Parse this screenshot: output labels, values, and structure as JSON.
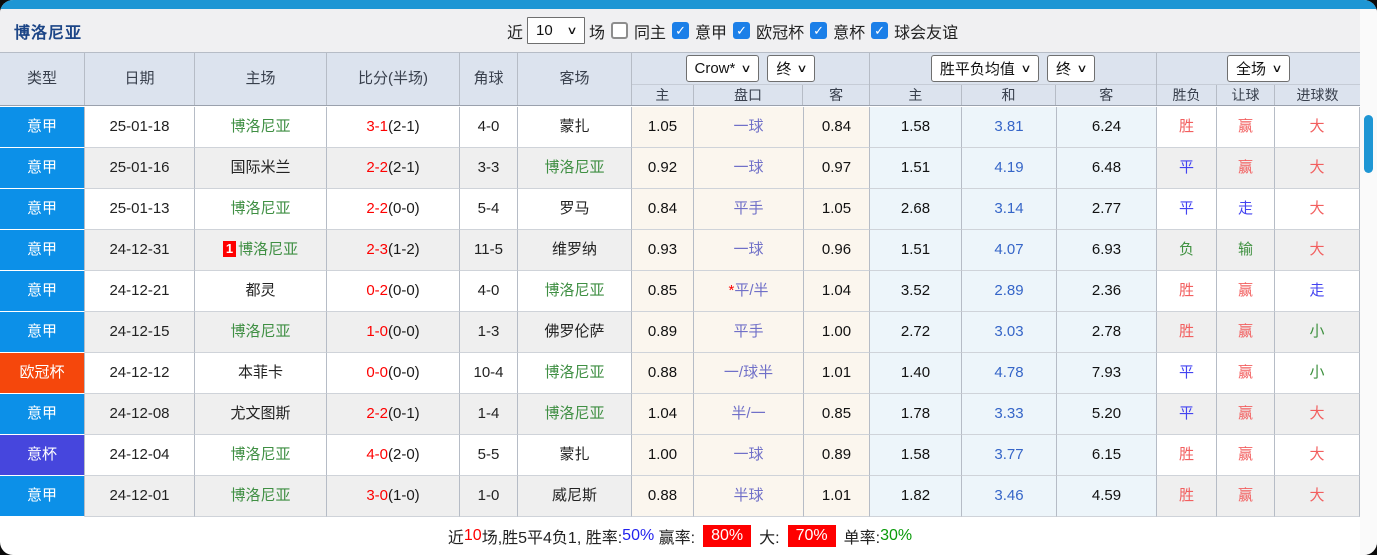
{
  "toolbar": {
    "title": "博洛尼亚",
    "recent_label": "近",
    "recent_value": "10",
    "games_label": "场",
    "same_home_label": "同主",
    "same_home_checked": false,
    "filters": [
      {
        "label": "意甲",
        "checked": true
      },
      {
        "label": "欧冠杯",
        "checked": true
      },
      {
        "label": "意杯",
        "checked": true
      },
      {
        "label": "球会友谊",
        "checked": true
      }
    ],
    "check_glyph": "✓"
  },
  "header": {
    "left_cols": [
      "类型",
      "日期",
      "主场",
      "比分(半场)",
      "角球",
      "客场"
    ],
    "odds_group": {
      "bookmaker": "Crow*",
      "period": "终",
      "sub": [
        "主",
        "盘口",
        "客"
      ]
    },
    "avg_group": {
      "metric": "胜平负均值",
      "period": "终",
      "sub": [
        "主",
        "和",
        "客"
      ]
    },
    "result_group": {
      "scope": "全场",
      "sub": [
        "胜负",
        "让球",
        "进球数"
      ]
    },
    "chevron": "∨"
  },
  "rows": [
    {
      "type": "意甲",
      "date": "25-01-18",
      "home": "博洛尼亚",
      "home_is_team": true,
      "home_badge": "",
      "score": "3-1",
      "half": "(2-1)",
      "corner": "4-0",
      "away": "蒙扎",
      "away_is_team": false,
      "odds_home": "1.05",
      "handicap_prefix": "",
      "handicap": "一球",
      "odds_away": "0.84",
      "avg_home": "1.58",
      "avg_draw": "3.81",
      "avg_away": "6.24",
      "result": "胜",
      "let_ball": "赢",
      "goals": "大"
    },
    {
      "type": "意甲",
      "date": "25-01-16",
      "home": "国际米兰",
      "home_is_team": false,
      "home_badge": "",
      "score": "2-2",
      "half": "(2-1)",
      "corner": "3-3",
      "away": "博洛尼亚",
      "away_is_team": true,
      "odds_home": "0.92",
      "handicap_prefix": "",
      "handicap": "一球",
      "odds_away": "0.97",
      "avg_home": "1.51",
      "avg_draw": "4.19",
      "avg_away": "6.48",
      "result": "平",
      "let_ball": "赢",
      "goals": "大"
    },
    {
      "type": "意甲",
      "date": "25-01-13",
      "home": "博洛尼亚",
      "home_is_team": true,
      "home_badge": "",
      "score": "2-2",
      "half": "(0-0)",
      "corner": "5-4",
      "away": "罗马",
      "away_is_team": false,
      "odds_home": "0.84",
      "handicap_prefix": "",
      "handicap": "平手",
      "odds_away": "1.05",
      "avg_home": "2.68",
      "avg_draw": "3.14",
      "avg_away": "2.77",
      "result": "平",
      "let_ball": "走",
      "goals": "大"
    },
    {
      "type": "意甲",
      "date": "24-12-31",
      "home": "博洛尼亚",
      "home_is_team": true,
      "home_badge": "1",
      "score": "2-3",
      "half": "(1-2)",
      "corner": "11-5",
      "away": "维罗纳",
      "away_is_team": false,
      "odds_home": "0.93",
      "handicap_prefix": "",
      "handicap": "一球",
      "odds_away": "0.96",
      "avg_home": "1.51",
      "avg_draw": "4.07",
      "avg_away": "6.93",
      "result": "负",
      "let_ball": "输",
      "goals": "大"
    },
    {
      "type": "意甲",
      "date": "24-12-21",
      "home": "都灵",
      "home_is_team": false,
      "home_badge": "",
      "score": "0-2",
      "half": "(0-0)",
      "corner": "4-0",
      "away": "博洛尼亚",
      "away_is_team": true,
      "odds_home": "0.85",
      "handicap_prefix": "*",
      "handicap": "平/半",
      "odds_away": "1.04",
      "avg_home": "3.52",
      "avg_draw": "2.89",
      "avg_away": "2.36",
      "result": "胜",
      "let_ball": "赢",
      "goals": "走"
    },
    {
      "type": "意甲",
      "date": "24-12-15",
      "home": "博洛尼亚",
      "home_is_team": true,
      "home_badge": "",
      "score": "1-0",
      "half": "(0-0)",
      "corner": "1-3",
      "away": "佛罗伦萨",
      "away_is_team": false,
      "odds_home": "0.89",
      "handicap_prefix": "",
      "handicap": "平手",
      "odds_away": "1.00",
      "avg_home": "2.72",
      "avg_draw": "3.03",
      "avg_away": "2.78",
      "result": "胜",
      "let_ball": "赢",
      "goals": "小"
    },
    {
      "type": "欧冠杯",
      "date": "24-12-12",
      "home": "本菲卡",
      "home_is_team": false,
      "home_badge": "",
      "score": "0-0",
      "half": "(0-0)",
      "corner": "10-4",
      "away": "博洛尼亚",
      "away_is_team": true,
      "odds_home": "0.88",
      "handicap_prefix": "",
      "handicap": "一/球半",
      "odds_away": "1.01",
      "avg_home": "1.40",
      "avg_draw": "4.78",
      "avg_away": "7.93",
      "result": "平",
      "let_ball": "赢",
      "goals": "小"
    },
    {
      "type": "意甲",
      "date": "24-12-08",
      "home": "尤文图斯",
      "home_is_team": false,
      "home_badge": "",
      "score": "2-2",
      "half": "(0-1)",
      "corner": "1-4",
      "away": "博洛尼亚",
      "away_is_team": true,
      "odds_home": "1.04",
      "handicap_prefix": "",
      "handicap": "半/一",
      "odds_away": "0.85",
      "avg_home": "1.78",
      "avg_draw": "3.33",
      "avg_away": "5.20",
      "result": "平",
      "let_ball": "赢",
      "goals": "大"
    },
    {
      "type": "意杯",
      "date": "24-12-04",
      "home": "博洛尼亚",
      "home_is_team": true,
      "home_badge": "",
      "score": "4-0",
      "half": "(2-0)",
      "corner": "5-5",
      "away": "蒙扎",
      "away_is_team": false,
      "odds_home": "1.00",
      "handicap_prefix": "",
      "handicap": "一球",
      "odds_away": "0.89",
      "avg_home": "1.58",
      "avg_draw": "3.77",
      "avg_away": "6.15",
      "result": "胜",
      "let_ball": "赢",
      "goals": "大"
    },
    {
      "type": "意甲",
      "date": "24-12-01",
      "home": "博洛尼亚",
      "home_is_team": true,
      "home_badge": "",
      "score": "3-0",
      "half": "(1-0)",
      "corner": "1-0",
      "away": "威尼斯",
      "away_is_team": false,
      "odds_home": "0.88",
      "handicap_prefix": "",
      "handicap": "半球",
      "odds_away": "1.01",
      "avg_home": "1.82",
      "avg_draw": "3.46",
      "avg_away": "4.59",
      "result": "胜",
      "let_ball": "赢",
      "goals": "大"
    }
  ],
  "summary": {
    "seg_recent": "近",
    "count": "10",
    "seg_record": "场,胜5平4负1, 胜率:",
    "win_rate": "50%",
    "win_label": " 赢率:",
    "win_badge": "80%",
    "big_label": "大:",
    "big_badge": "70%",
    "single_label": "单率:",
    "single_rate": "30%"
  },
  "colors": {
    "league": {
      "意甲": "#0c90e8",
      "欧冠杯": "#f5470c",
      "意杯": "#4646dd"
    },
    "team_green": "#3f8f43",
    "score_red": "#fe0000",
    "handicap_text": "#7070c8",
    "avg_draw_blue": "#3565c8",
    "outcome": {
      "胜": "#f25f5f",
      "平": "#4343f0",
      "负": "#3f9140"
    },
    "handicap_result": {
      "赢": "#f25f5f",
      "输": "#3f9140",
      "走": "#4343f0"
    },
    "goal_result": {
      "大": "#f25f5f",
      "小": "#3f9140",
      "走": "#4343f0"
    },
    "win_rate_blue": "#2222ee",
    "single_green": "#089a08",
    "accent_bar": "#1e96d4"
  }
}
